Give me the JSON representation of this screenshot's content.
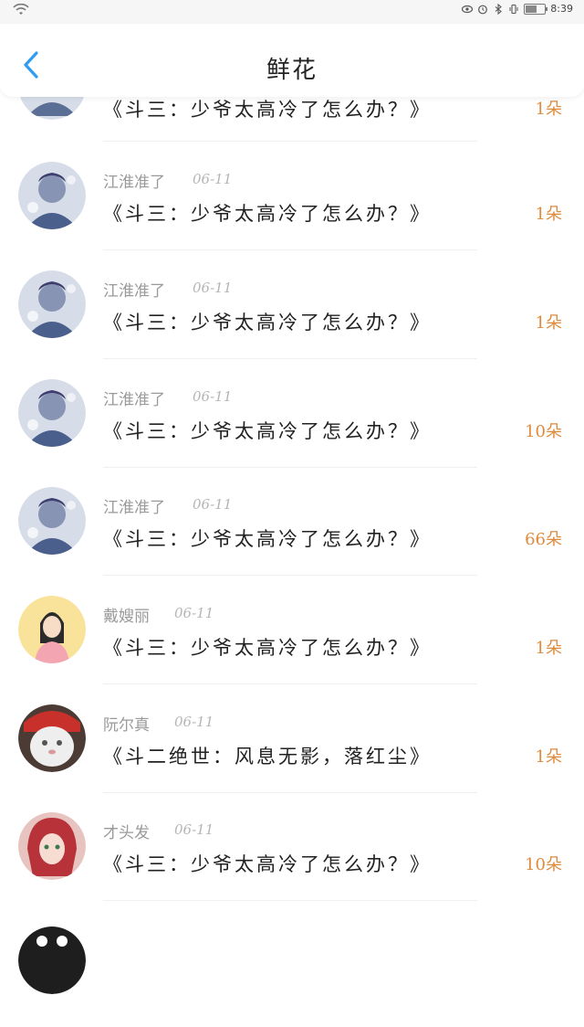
{
  "status_bar": {
    "time": "8:39",
    "icons": [
      "wifi-icon",
      "eye-icon",
      "alarm-icon",
      "bluetooth-icon",
      "vibrate-icon",
      "battery-icon"
    ]
  },
  "header": {
    "title": "鲜花",
    "back_icon": "chevron-left-icon",
    "accent_color": "#2e9cf2"
  },
  "rows": [
    {
      "name": "",
      "date": "",
      "book": "《斗三：少爷太高冷了怎么办？》",
      "count": "1朵",
      "avatar": "anime-silver"
    },
    {
      "name": "江淮准了",
      "date": "06-11",
      "book": "《斗三：少爷太高冷了怎么办？》",
      "count": "1朵",
      "avatar": "anime-silver"
    },
    {
      "name": "江淮准了",
      "date": "06-11",
      "book": "《斗三：少爷太高冷了怎么办？》",
      "count": "1朵",
      "avatar": "anime-silver"
    },
    {
      "name": "江淮准了",
      "date": "06-11",
      "book": "《斗三：少爷太高冷了怎么办？》",
      "count": "10朵",
      "avatar": "anime-silver"
    },
    {
      "name": "江淮准了",
      "date": "06-11",
      "book": "《斗三：少爷太高冷了怎么办？》",
      "count": "66朵",
      "avatar": "anime-silver"
    },
    {
      "name": "戴嫂丽",
      "date": "06-11",
      "book": "《斗三：少爷太高冷了怎么办？》",
      "count": "1朵",
      "avatar": "cartoon-girl"
    },
    {
      "name": "阮尔真",
      "date": "06-11",
      "book": "《斗二绝世：风息无影，落红尘》",
      "count": "1朵",
      "avatar": "cat"
    },
    {
      "name": "才头发",
      "date": "06-11",
      "book": "《斗三：少爷太高冷了怎么办？》",
      "count": "10朵",
      "avatar": "anime-red"
    },
    {
      "name": "",
      "date": "",
      "book": "",
      "count": "",
      "avatar": "dark"
    }
  ],
  "colors": {
    "count": "#e08a3c",
    "name": "#9a9a9a"
  }
}
